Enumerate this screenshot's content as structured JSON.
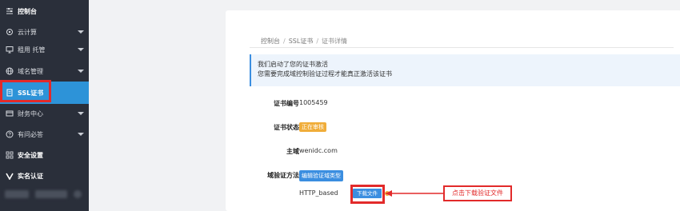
{
  "sidebar": {
    "items": [
      {
        "label": "控制台",
        "icon": "sliders-icon"
      },
      {
        "label": "云计算",
        "icon": "cloud-icon"
      },
      {
        "label": "租用 托管",
        "icon": "monitor-icon"
      },
      {
        "label": "域名管理",
        "icon": "globe-icon"
      },
      {
        "label": "SSL证书",
        "icon": "certificate-icon"
      },
      {
        "label": "财务中心",
        "icon": "finance-icon"
      },
      {
        "label": "有问必答",
        "icon": "help-icon"
      },
      {
        "label": "安全设置",
        "icon": "grid-icon"
      },
      {
        "label": "实名认证",
        "icon": "verify-icon"
      }
    ],
    "active_item": "SSL证书"
  },
  "breadcrumb": [
    "控制台",
    "SSL证书",
    "证书详情"
  ],
  "notice": {
    "line1": "我们启动了您的证书激活",
    "line2": "您需要完成域控制验证过程才能真正激活该证书"
  },
  "cert": {
    "number_label": "证书编号",
    "number_value": "1005459",
    "status_label": "证书状态",
    "status_value": "正在审核",
    "domain_label": "主域",
    "domain_value": "wenidc.com",
    "method_label": "域验证方法",
    "method_button": "编辑验证域类型",
    "method_value": "HTTP_based",
    "download_button": "下载文件"
  },
  "annotation": {
    "callout_text": "点击下载验证文件"
  },
  "colors": {
    "sidebar_bg": "#2a2f3a",
    "active": "#2d93d8",
    "highlight": "#e22a2a",
    "badge_orange": "#f0ad3a",
    "accent_blue": "#3b8ee0"
  }
}
